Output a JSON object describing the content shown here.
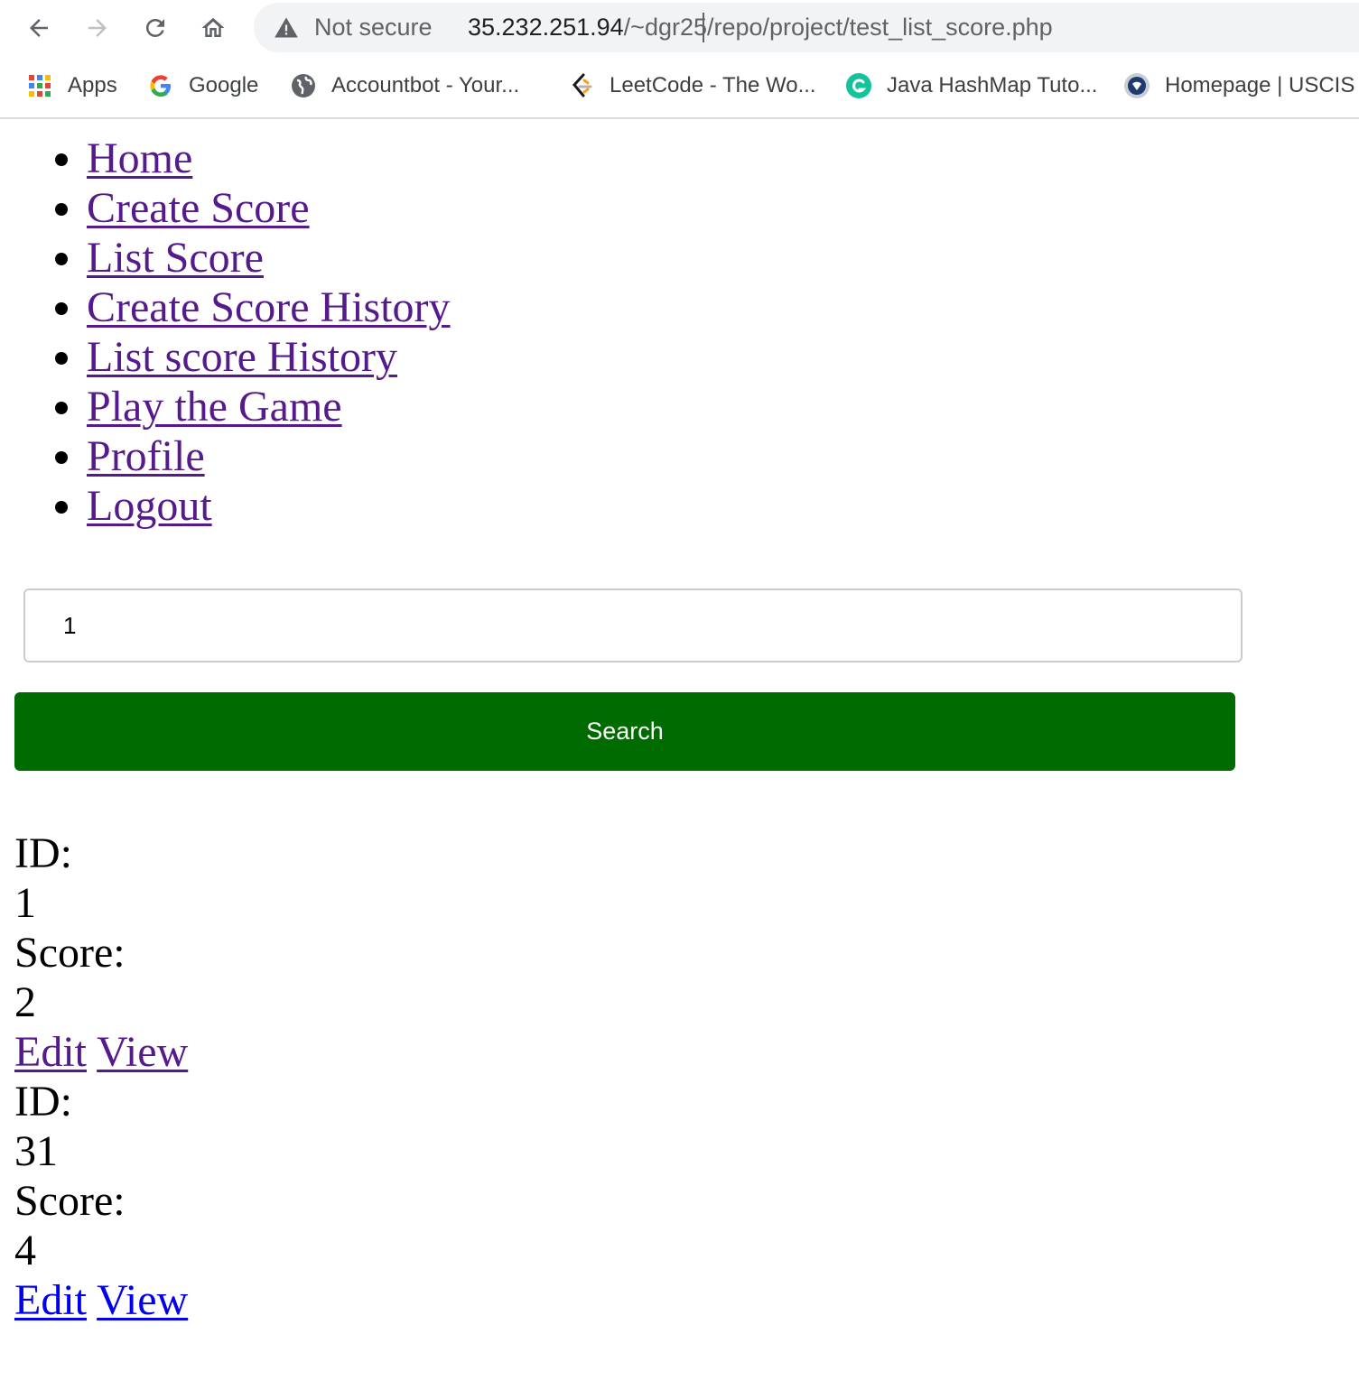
{
  "browser": {
    "security_label": "Not secure",
    "url_host": "35.232.251.94",
    "url_path": "/~dgr25/repo/project/test_list_score.php",
    "bookmarks": [
      {
        "label": "Apps",
        "icon": "apps-grid-icon"
      },
      {
        "label": "Google",
        "icon": "google-icon"
      },
      {
        "label": "Accountbot - Your...",
        "icon": "globe-icon"
      },
      {
        "label": "LeetCode - The Wo...",
        "icon": "leetcode-icon"
      },
      {
        "label": "Java HashMap Tuto...",
        "icon": "grammarly-icon"
      },
      {
        "label": "Homepage | USCIS",
        "icon": "uscis-seal-icon"
      }
    ]
  },
  "nav": {
    "items": [
      {
        "label": "Home"
      },
      {
        "label": "Create Score"
      },
      {
        "label": "List Score"
      },
      {
        "label": "Create Score History"
      },
      {
        "label": "List score History"
      },
      {
        "label": "Play the Game"
      },
      {
        "label": "Profile"
      },
      {
        "label": "Logout"
      }
    ]
  },
  "search": {
    "value": "1",
    "button_label": "Search"
  },
  "results": [
    {
      "id_label": "ID:",
      "id": "1",
      "score_label": "Score:",
      "score": "2",
      "edit_label": "Edit",
      "view_label": "View"
    },
    {
      "id_label": "ID:",
      "id": "31",
      "score_label": "Score:",
      "score": "4",
      "edit_label": "Edit",
      "view_label": "View"
    }
  ],
  "colors": {
    "visited_link": "#551a8b",
    "unvisited_link": "#0000ee",
    "search_button": "#006b00"
  }
}
